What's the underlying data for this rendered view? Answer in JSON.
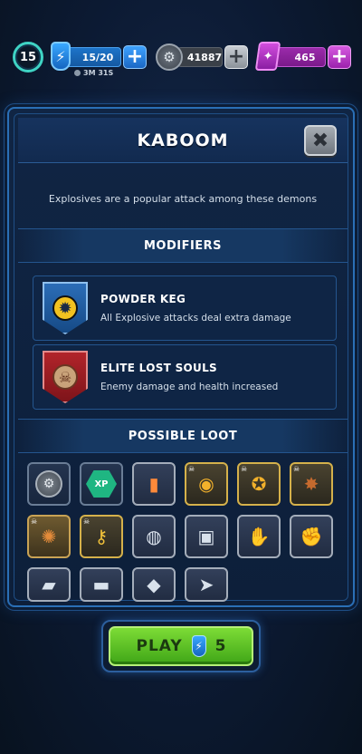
{
  "topbar": {
    "level": "15",
    "energy": "15/20",
    "energy_timer": "3M 31S",
    "coins": "41887",
    "gems": "465",
    "plus": "+"
  },
  "panel": {
    "title": "KABOOM",
    "close": "✖",
    "description": "Explosives are a popular attack among these demons",
    "modifiers_heading": "MODIFIERS",
    "modifiers": [
      {
        "name": "POWDER KEG",
        "desc": "All Explosive attacks deal extra damage",
        "icon": "explosion-badge-icon"
      },
      {
        "name": "ELITE LOST SOULS",
        "desc": "Enemy damage and health increased",
        "icon": "demon-skull-badge-icon"
      }
    ],
    "loot_heading": "POSSIBLE LOOT",
    "loot": [
      {
        "icon": "coin-icon",
        "label": ""
      },
      {
        "icon": "xp-icon",
        "label": "XP"
      },
      {
        "icon": "rocket-ammo-icon",
        "label": ""
      },
      {
        "icon": "gold-visor-helmet-icon",
        "label": ""
      },
      {
        "icon": "gold-cannon-icon",
        "label": ""
      },
      {
        "icon": "demon-trophy-icon",
        "label": ""
      },
      {
        "icon": "gold-shield-icon",
        "label": ""
      },
      {
        "icon": "gold-key-icon",
        "label": ""
      },
      {
        "icon": "silver-helmet-icon",
        "label": ""
      },
      {
        "icon": "silver-armor-icon",
        "label": ""
      },
      {
        "icon": "silver-gloves-icon",
        "label": ""
      },
      {
        "icon": "silver-fist-icon",
        "label": ""
      },
      {
        "icon": "silver-launcher-icon",
        "label": ""
      },
      {
        "icon": "silver-rifle-icon",
        "label": ""
      },
      {
        "icon": "silver-blaster-icon",
        "label": ""
      },
      {
        "icon": "silver-shotgun-icon",
        "label": ""
      }
    ]
  },
  "play": {
    "label": "PLAY",
    "cost": "5"
  }
}
